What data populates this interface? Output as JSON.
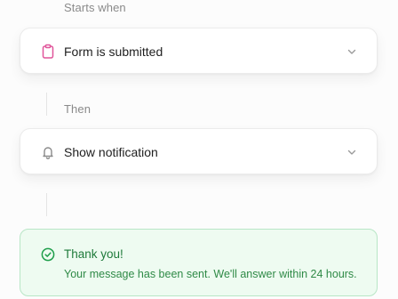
{
  "workflow": {
    "trigger_section_label": "Starts when",
    "trigger": {
      "title": "Form is submitted",
      "icon": "clipboard-icon",
      "icon_color": "#e0559a"
    },
    "action_section_label": "Then",
    "action": {
      "title": "Show notification",
      "icon": "bell-icon",
      "icon_color": "#8a8a8a"
    }
  },
  "notification": {
    "icon": "check-circle-icon",
    "title": "Thank you!",
    "message": "Your message has been sent. We'll answer within 24 hours.",
    "accent_color": "#1e9e4a",
    "background_color": "#eefbf1"
  }
}
